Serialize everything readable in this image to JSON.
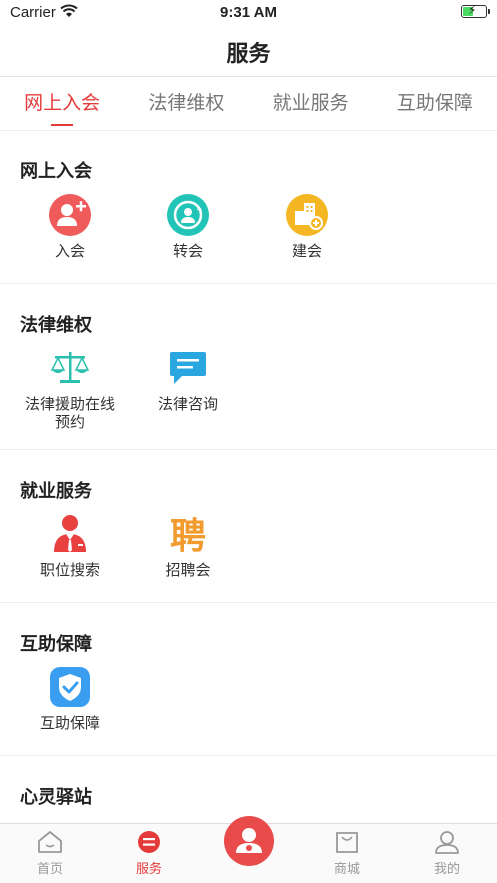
{
  "status_bar": {
    "carrier": "Carrier",
    "time": "9:31 AM",
    "battery_level": 0.45
  },
  "nav": {
    "title": "服务"
  },
  "tabs": [
    {
      "label": "网上入会",
      "active": true
    },
    {
      "label": "法律维权",
      "active": false
    },
    {
      "label": "就业服务",
      "active": false
    },
    {
      "label": "互助保障",
      "active": false
    }
  ],
  "sections": {
    "join": {
      "title": "网上入会",
      "items": [
        {
          "label": "入会"
        },
        {
          "label": "转会"
        },
        {
          "label": "建会"
        }
      ]
    },
    "legal": {
      "title": "法律维权",
      "items": [
        {
          "label": "法律援助在线\n预约"
        },
        {
          "label": "法律咨询"
        }
      ]
    },
    "employment": {
      "title": "就业服务",
      "items": [
        {
          "label": "职位搜索"
        },
        {
          "label": "招聘会"
        }
      ]
    },
    "mutual": {
      "title": "互助保障",
      "items": [
        {
          "label": "互助保障"
        }
      ]
    },
    "mental": {
      "title": "心灵驿站"
    }
  },
  "tabbar": {
    "home": "首页",
    "service": "服务",
    "mall": "商城",
    "mine": "我的"
  },
  "colors": {
    "accent": "#e53a3a",
    "inactive": "#999999"
  },
  "icons": {
    "join": "user-add-icon",
    "transfer": "user-transfer-icon",
    "build": "building-add-icon",
    "legal_aid": "scales-icon",
    "legal_consult": "chat-bubble-icon",
    "job_search": "person-tie-icon",
    "job_fair": "recruit-character-icon",
    "mutual": "shield-check-icon"
  }
}
